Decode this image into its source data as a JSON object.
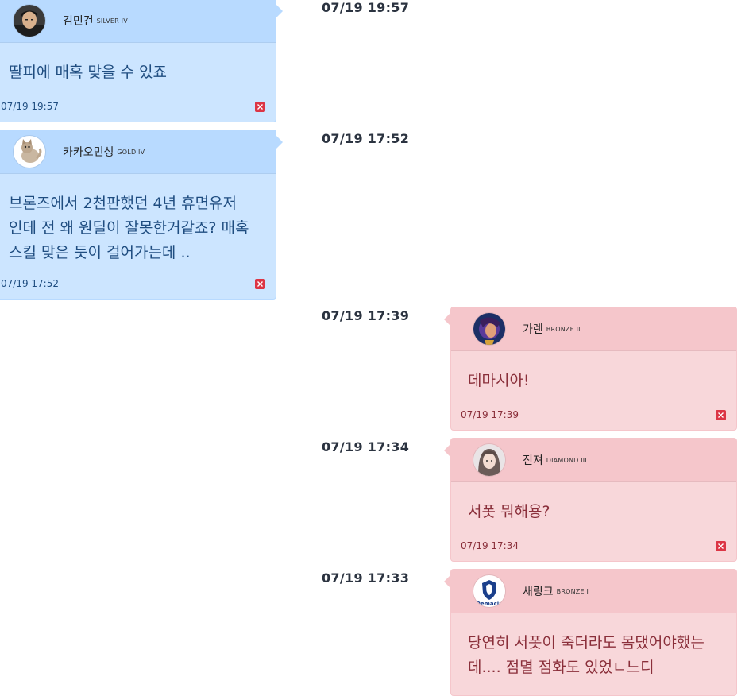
{
  "messages": [
    {
      "timestamp": "07/19 19:57",
      "name": "김민건",
      "tier": "SILVER IV",
      "text": "딸피에 매혹 맞을 수 있죠",
      "footer_time": "07/19 19:57",
      "side": "left",
      "avatar_icon": "user-photo-icon"
    },
    {
      "timestamp": "07/19 17:52",
      "name": "카카오민성",
      "tier": "GOLD IV",
      "text": "브론즈에서 2천판했던 4년 휴면유저\n인데 전 왜 원딜이 잘못한거같죠? 매혹\n스킬 맞은 듯이 걸어가는데 ..",
      "footer_time": "07/19 17:52",
      "side": "left",
      "avatar_icon": "cat-avatar-icon"
    },
    {
      "timestamp": "07/19 17:39",
      "name": "가렌",
      "tier": "BRONZE II",
      "text": "데마시아!",
      "footer_time": "07/19 17:39",
      "side": "right",
      "avatar_icon": "champion-avatar-icon"
    },
    {
      "timestamp": "07/19 17:34",
      "name": "진져",
      "tier": "DIAMOND III",
      "text": "서폿 뭐해용?",
      "footer_time": "07/19 17:34",
      "side": "right",
      "avatar_icon": "girl-avatar-icon"
    },
    {
      "timestamp": "07/19 17:33",
      "name": "새링크",
      "tier": "BRONZE I",
      "text": "당연히 서폿이 죽더라도 몸댔어야했는\n데.... 점멸 점화도 있었ㄴ느디",
      "footer_time": "",
      "side": "right",
      "avatar_icon": "demacia-logo-icon",
      "avatar_text": "Demacia"
    }
  ],
  "colors": {
    "left_bg": "#cce5ff",
    "left_header": "#b8daff",
    "right_bg": "#f8d7da",
    "right_header": "#f5c6cb",
    "delete": "#dc3545"
  }
}
